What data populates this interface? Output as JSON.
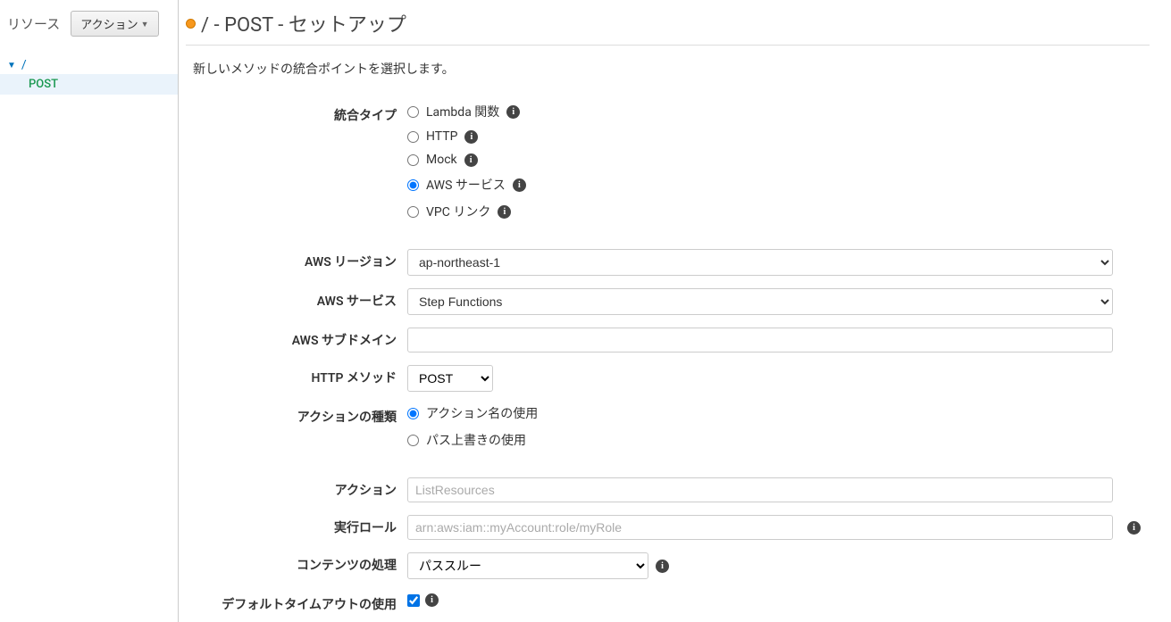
{
  "sidebar": {
    "title": "リソース",
    "action_button": "アクション",
    "tree": {
      "root": "/",
      "child": "POST"
    }
  },
  "header": {
    "title": "/ - POST - セットアップ"
  },
  "intro": "新しいメソッドの統合ポイントを選択します。",
  "form": {
    "integration_type": {
      "label": "統合タイプ",
      "options": {
        "lambda": "Lambda 関数",
        "http": "HTTP",
        "mock": "Mock",
        "aws": "AWS サービス",
        "vpc": "VPC リンク"
      },
      "selected": "aws"
    },
    "aws_region": {
      "label": "AWS リージョン",
      "value": "ap-northeast-1"
    },
    "aws_service": {
      "label": "AWS サービス",
      "value": "Step Functions"
    },
    "aws_subdomain": {
      "label": "AWS サブドメイン",
      "value": ""
    },
    "http_method": {
      "label": "HTTP メソッド",
      "value": "POST"
    },
    "action_type": {
      "label": "アクションの種類",
      "options": {
        "name": "アクション名の使用",
        "path": "パス上書きの使用"
      },
      "selected": "name"
    },
    "action": {
      "label": "アクション",
      "placeholder": "ListResources",
      "value": ""
    },
    "execution_role": {
      "label": "実行ロール",
      "placeholder": "arn:aws:iam::myAccount:role/myRole",
      "value": ""
    },
    "content_handling": {
      "label": "コンテンツの処理",
      "value": "パススルー"
    },
    "default_timeout": {
      "label": "デフォルトタイムアウトの使用",
      "checked": true
    }
  }
}
